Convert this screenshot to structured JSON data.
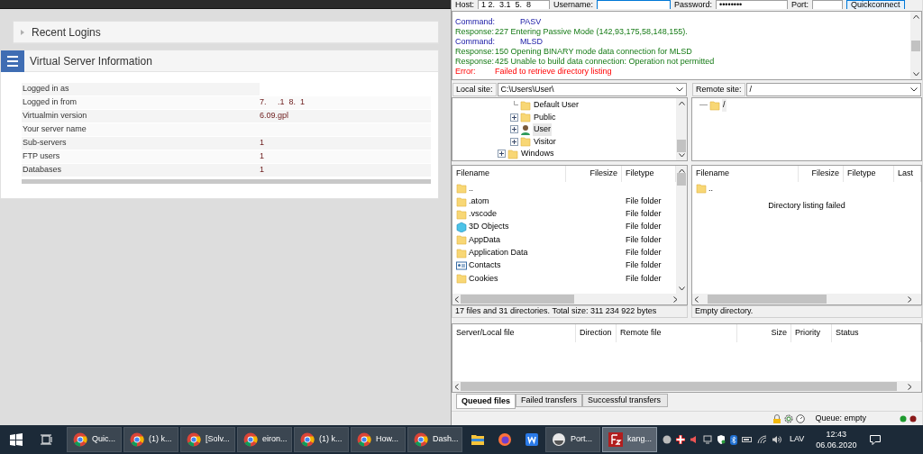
{
  "browser_page": {
    "panels": [
      {
        "title": "Recent Logins",
        "expanded": false
      },
      {
        "title": "Virtual Server Information",
        "expanded": true
      }
    ],
    "info_rows": [
      {
        "label": "Logged in as",
        "value": ""
      },
      {
        "label": "Logged in from",
        "value": "7.     .1  8.  1"
      },
      {
        "label": "Virtualmin version",
        "value": "6.09.gpl"
      },
      {
        "label": "Your server name",
        "value": ""
      },
      {
        "label": "Sub-servers",
        "value": "1"
      },
      {
        "label": "FTP users",
        "value": "1"
      },
      {
        "label": "Databases",
        "value": "1"
      }
    ]
  },
  "ftp_client": {
    "quickconnect": {
      "host_label": "Host:",
      "host": "1 2.  3.1  5.  8",
      "username_label": "Username:",
      "password_label": "Password:",
      "password": "••••••••",
      "port_label": "Port:",
      "button": "Quickconnect"
    },
    "log": [
      {
        "kind": "command",
        "prefix": "Command:",
        "text": "PASV"
      },
      {
        "kind": "response",
        "prefix": "Response:",
        "text": "227 Entering Passive Mode (142,93,175,58,148,155)."
      },
      {
        "kind": "command",
        "prefix": "Command:",
        "text": "MLSD"
      },
      {
        "kind": "response",
        "prefix": "Response:",
        "text": "150 Opening BINARY mode data connection for MLSD"
      },
      {
        "kind": "response",
        "prefix": "Response:",
        "text": "425 Unable to build data connection: Operation not permitted"
      },
      {
        "kind": "error",
        "prefix": "Error:",
        "text": "Failed to retrieve directory listing"
      }
    ],
    "local_site": {
      "label": "Local site:",
      "path": "C:\\Users\\User\\"
    },
    "remote_site": {
      "label": "Remote site:",
      "path": "/"
    },
    "local_tree": [
      {
        "name": "Default User",
        "kind": "folder",
        "expandable": false,
        "selected": false
      },
      {
        "name": "Public",
        "kind": "folder",
        "expandable": true,
        "selected": false
      },
      {
        "name": "User",
        "kind": "user",
        "expandable": true,
        "selected": true
      },
      {
        "name": "Visitor",
        "kind": "folder",
        "expandable": true,
        "selected": false
      }
    ],
    "local_tree_root": {
      "name": "Windows",
      "kind": "folder",
      "expandable": true
    },
    "remote_tree": [
      {
        "name": "/",
        "kind": "folder"
      }
    ],
    "local_columns": [
      "Filename",
      "Filesize",
      "Filetype"
    ],
    "local_files": [
      {
        "name": "..",
        "kind": "folder"
      },
      {
        "name": ".atom",
        "type": "File folder",
        "kind": "folder"
      },
      {
        "name": ".vscode",
        "type": "File folder",
        "kind": "folder"
      },
      {
        "name": "3D Objects",
        "type": "File folder",
        "kind": "cube"
      },
      {
        "name": "AppData",
        "type": "File folder",
        "kind": "folder"
      },
      {
        "name": "Application Data",
        "type": "File folder",
        "kind": "folder"
      },
      {
        "name": "Contacts",
        "type": "File folder",
        "kind": "contacts"
      },
      {
        "name": "Cookies",
        "type": "File folder",
        "kind": "folder"
      }
    ],
    "local_status": "17 files and 31 directories. Total size: 311 234 922 bytes",
    "remote_columns": [
      "Filename",
      "Filesize",
      "Filetype",
      "Last"
    ],
    "remote_files": [
      {
        "name": "..",
        "kind": "folder"
      }
    ],
    "remote_message": "Directory listing failed",
    "remote_status": "Empty directory.",
    "queue_columns": [
      "Server/Local file",
      "Direction",
      "Remote file",
      "Size",
      "Priority",
      "Status"
    ],
    "queue_tabs": [
      {
        "label": "Queued files",
        "selected": true
      },
      {
        "label": "Failed transfers",
        "selected": false
      },
      {
        "label": "Successful transfers",
        "selected": false
      }
    ],
    "queue_status": "Queue: empty"
  },
  "taskbar": {
    "buttons": [
      {
        "kind": "chrome",
        "label": "Quic..."
      },
      {
        "kind": "chrome",
        "label": "(1) k..."
      },
      {
        "kind": "chrome",
        "label": "[Solv..."
      },
      {
        "kind": "chrome",
        "label": "eiron..."
      },
      {
        "kind": "chrome",
        "label": "(1) k..."
      },
      {
        "kind": "chrome",
        "label": "How..."
      },
      {
        "kind": "chrome",
        "label": "Dash..."
      },
      {
        "kind": "explorer"
      },
      {
        "kind": "firefox"
      },
      {
        "kind": "wps"
      },
      {
        "kind": "app",
        "label": "Port..."
      },
      {
        "kind": "filezilla",
        "label": "kang...",
        "selected": true
      }
    ],
    "language": "LAV",
    "time": "12:43",
    "date": "06.06.2020"
  }
}
